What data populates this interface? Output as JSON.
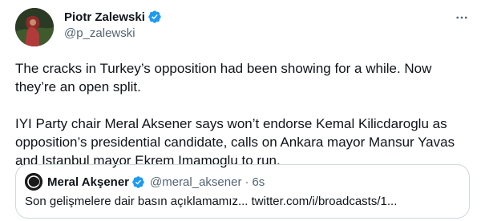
{
  "author": {
    "name": "Piotr Zalewski",
    "handle": "@p_zalewski",
    "verified": true
  },
  "tweet": {
    "paragraphs": [
      "The cracks in Turkey’s opposition had been showing for a while. Now they’re an open split.",
      "IYI Party chair Meral Aksener says won’t endorse Kemal Kilicdaroglu as opposition’s presidential candidate, calls on Ankara mayor Mansur Yavas and Istanbul mayor Ekrem Imamoglu to run."
    ]
  },
  "quote": {
    "name": "Meral Akşener",
    "handle": "@meral_aksener",
    "separator": "·",
    "time": "6s",
    "text": "Son gelişmelere dair basın açıklamamız... twitter.com/i/broadcasts/1..."
  },
  "colors": {
    "verified": "#1d9bf0",
    "secondary_text": "#536471",
    "primary_text": "#0f1419",
    "border": "#cfd9de"
  },
  "icons": {
    "more": "more-horizontal-icon",
    "verified": "verified-badge-icon"
  }
}
